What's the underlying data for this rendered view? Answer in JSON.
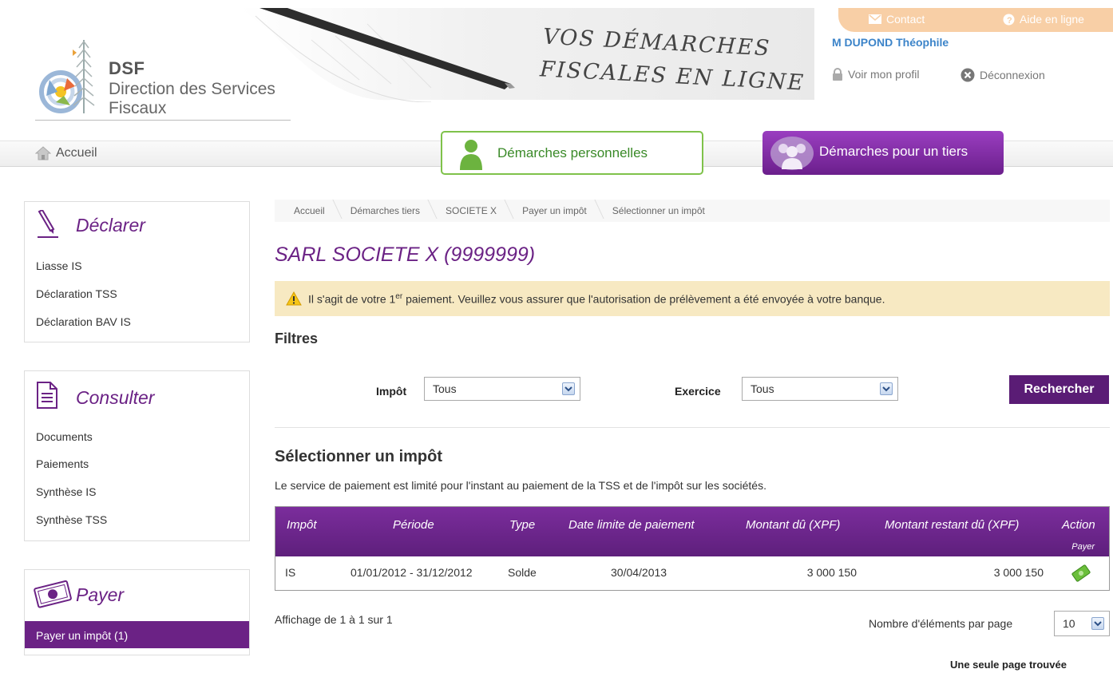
{
  "header": {
    "logo_abbr": "DSF",
    "logo_line1": "Direction des Services",
    "logo_line2": "Fiscaux",
    "banner_line1": "VOS DÉMARCHES",
    "banner_line2": "FISCALES EN LIGNE",
    "contact_label": "Contact",
    "help_label": "Aide en ligne",
    "user_name": "M DUPOND Théophile",
    "profile_label": "Voir mon profil",
    "logout_label": "Déconnexion"
  },
  "nav": {
    "home_label": "Accueil",
    "tab_personal": "Démarches personnelles",
    "tab_third_party": "Démarches pour un tiers"
  },
  "sidebar": {
    "declarer": {
      "title": "Déclarer",
      "items": [
        "Liasse IS",
        "Déclaration TSS",
        "Déclaration BAV IS"
      ]
    },
    "consulter": {
      "title": "Consulter",
      "items": [
        "Documents",
        "Paiements",
        "Synthèse IS",
        "Synthèse TSS"
      ]
    },
    "payer": {
      "title": "Payer",
      "items": [
        "Payer un impôt (1)"
      ]
    }
  },
  "breadcrumb": [
    "Accueil",
    "Démarches tiers",
    "SOCIETE X",
    "Payer un impôt",
    "Sélectionner un impôt"
  ],
  "page_title": "SARL SOCIETE X (9999999)",
  "alert": {
    "before": "Il s'agit de votre 1",
    "sup": "er",
    "after": " paiement. Veuillez vous assurer que l'autorisation de prélèvement a été envoyée à votre banque."
  },
  "filters": {
    "title": "Filtres",
    "impot_label": "Impôt",
    "impot_value": "Tous",
    "exercice_label": "Exercice",
    "exercice_value": "Tous",
    "search_button": "Rechercher"
  },
  "section": {
    "title": "Sélectionner un impôt",
    "description": "Le service de paiement est limité pour l'instant au paiement de la TSS et de l'impôt sur les sociétés."
  },
  "table": {
    "headers": [
      "Impôt",
      "Période",
      "Type",
      "Date limite de paiement",
      "Montant dû (XPF)",
      "Montant restant dû (XPF)",
      "Action"
    ],
    "sub_header": "Payer",
    "rows": [
      {
        "impot": "IS",
        "periode": "01/01/2012 - 31/12/2012",
        "type": "Solde",
        "date_limite": "30/04/2013",
        "montant_du": "3 000 150",
        "montant_restant": "3 000 150"
      }
    ]
  },
  "pagination": {
    "display_info": "Affichage de 1 à 1 sur 1",
    "per_page_label": "Nombre d'éléments par page",
    "per_page_value": "10",
    "pages_found": "Une seule page trouvée"
  },
  "colors": {
    "brand_purple": "#6b2285",
    "green": "#7fc24a",
    "alert_bg": "#f7e9c2"
  }
}
